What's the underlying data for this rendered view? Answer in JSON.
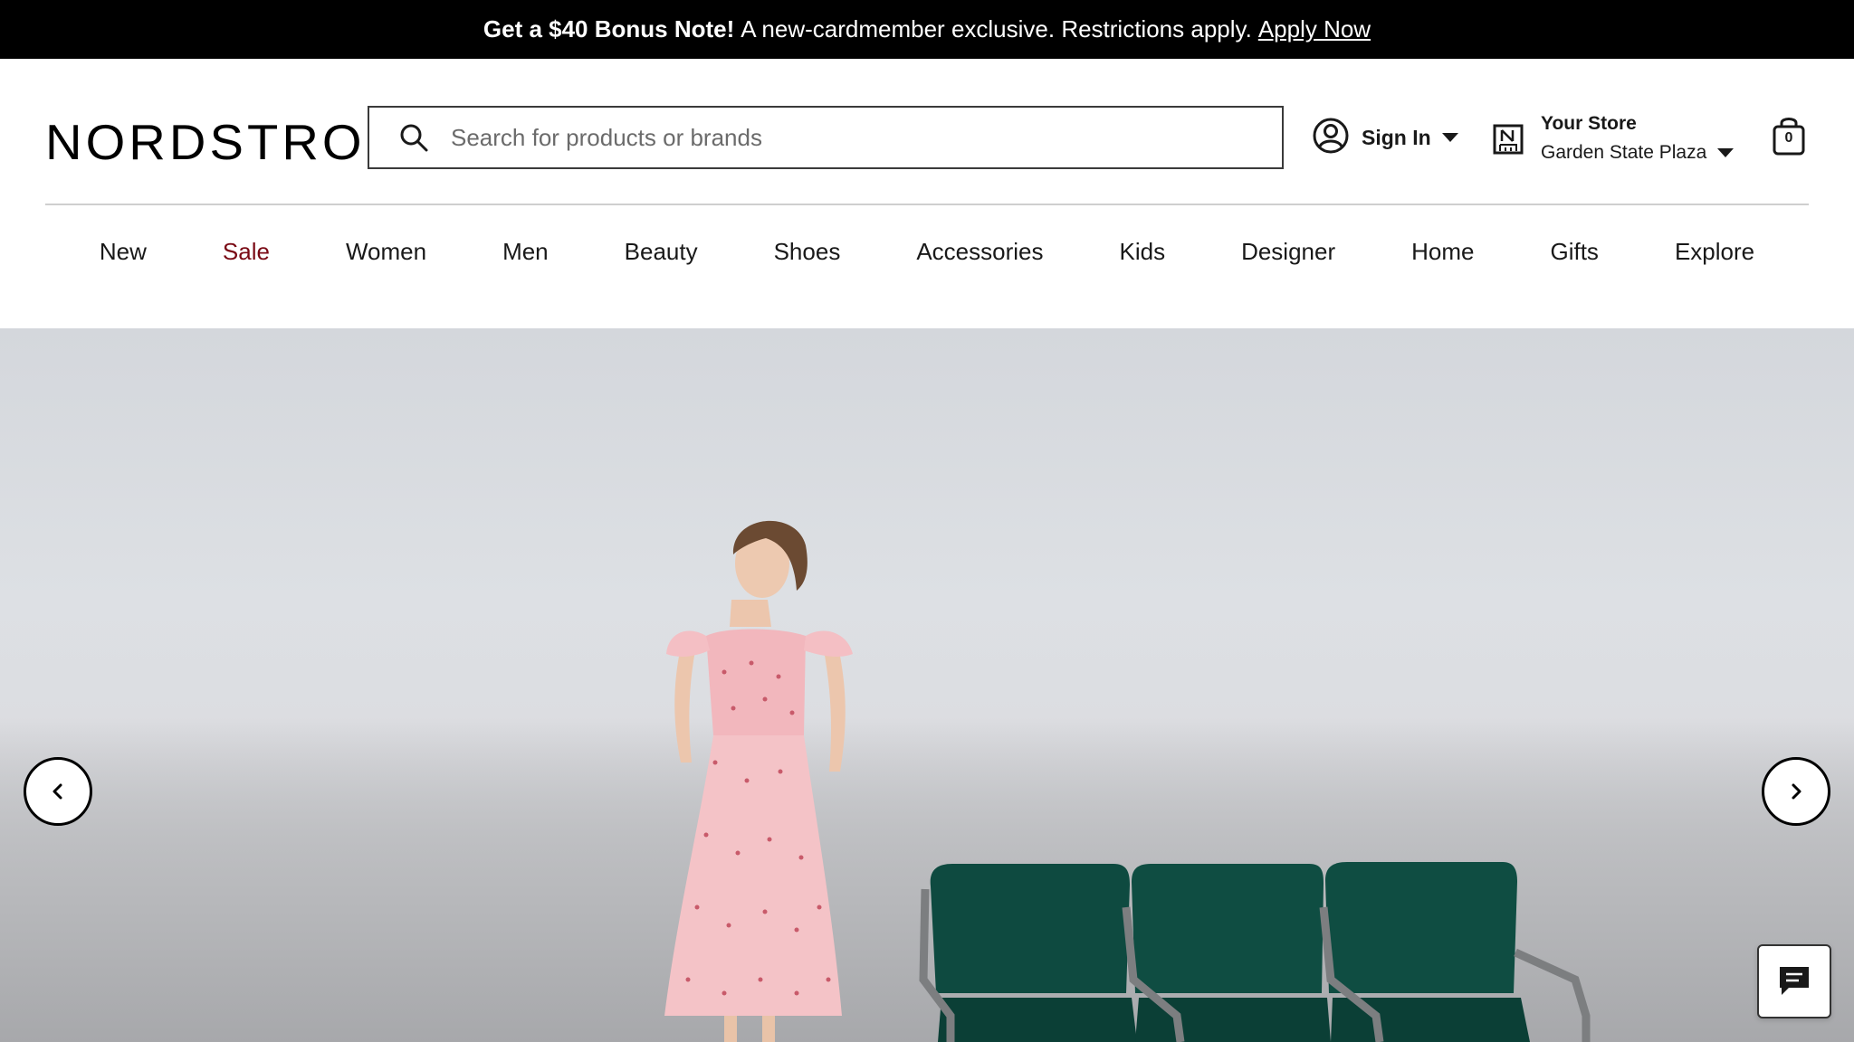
{
  "promo": {
    "headline": "Get a $40 Bonus Note!",
    "message": "A new-cardmember exclusive. Restrictions apply.",
    "link": "Apply Now"
  },
  "header": {
    "logo": "NORDSTROM",
    "search": {
      "placeholder": "Search for products or brands",
      "icon": "search-icon"
    },
    "account": {
      "label": "Sign In",
      "icon": "user-icon"
    },
    "store": {
      "title": "Your Store",
      "name": "Garden State Plaza",
      "icon": "store-icon"
    },
    "bag": {
      "count": "0",
      "icon": "shopping-bag-icon"
    }
  },
  "nav": {
    "items": [
      {
        "label": "New"
      },
      {
        "label": "Sale",
        "color": "#7a0a15"
      },
      {
        "label": "Women"
      },
      {
        "label": "Men"
      },
      {
        "label": "Beauty"
      },
      {
        "label": "Shoes"
      },
      {
        "label": "Accessories"
      },
      {
        "label": "Kids"
      },
      {
        "label": "Designer"
      },
      {
        "label": "Home"
      },
      {
        "label": "Gifts"
      },
      {
        "label": "Explore"
      }
    ]
  },
  "hero": {
    "prev_icon": "chevron-left-icon",
    "next_icon": "chevron-right-icon"
  },
  "chat": {
    "icon": "chat-icon"
  },
  "colors": {
    "promo_bg": "#000000",
    "sale": "#7a0a15",
    "chair_green": "#0e4a40",
    "dress_pink": "#f2b7bd"
  }
}
